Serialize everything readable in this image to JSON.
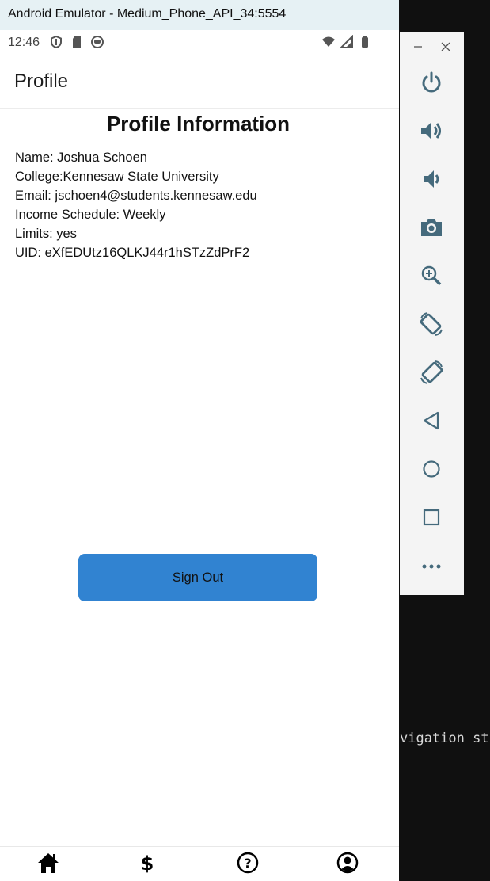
{
  "window": {
    "title": "Android Emulator - Medium_Phone_API_34:5554"
  },
  "status_bar": {
    "time": "12:46",
    "icons_left": [
      "shield-icon",
      "sd-card-icon",
      "robot-icon"
    ],
    "icons_right": [
      "wifi-icon",
      "signal-icon",
      "battery-icon"
    ]
  },
  "app": {
    "header_title": "Profile",
    "heading": "Profile Information",
    "info_lines": [
      "Name: Joshua Schoen",
      "College:Kennesaw State University",
      "Email: jschoen4@students.kennesaw.edu",
      "Income Schedule: Weekly",
      "Limits: yes",
      "UID: eXfEDUtz16QLKJ44r1hSTzZdPrF2"
    ],
    "signout_label": "Sign Out",
    "button_color": "#3183d1",
    "nav_tabs": [
      "home-icon",
      "dollar-icon",
      "help-icon",
      "account-icon"
    ]
  },
  "side_toolbar": {
    "window_controls": [
      "minimize-icon",
      "close-icon"
    ],
    "buttons": [
      "power-icon",
      "volume-up-icon",
      "volume-down-icon",
      "camera-icon",
      "zoom-icon",
      "rotate-left-icon",
      "rotate-right-icon",
      "back-icon",
      "home-circle-icon",
      "overview-icon",
      "more-icon"
    ]
  },
  "terminal": {
    "text": "vigation st"
  }
}
